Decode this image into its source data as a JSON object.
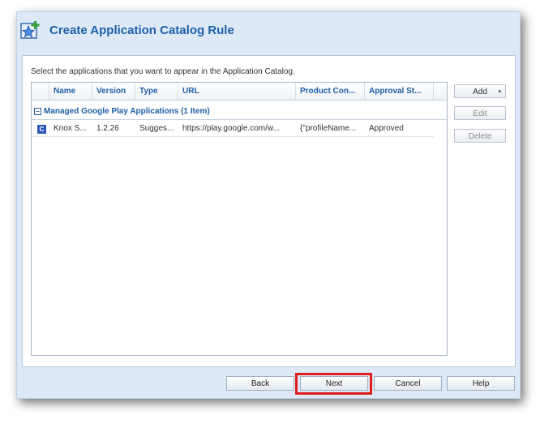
{
  "dialog": {
    "title": "Create Application Catalog Rule",
    "icon": "catalog-star-add-icon",
    "instruction": "Select the applications that you want to appear in the Application Catalog."
  },
  "grid": {
    "columns": [
      "Name",
      "Version",
      "Type",
      "URL",
      "Product Con...",
      "Approval St..."
    ],
    "group": {
      "toggle": "−",
      "label": "Managed Google Play Applications (1 Item)"
    },
    "rows": [
      {
        "icon_letter": "C",
        "name": "Knox S...",
        "version": "1.2.26",
        "type": "Sugges...",
        "url": "https://play.google.com/w...",
        "product_config": "{\"profileName...",
        "approval": "Approved"
      }
    ]
  },
  "side_buttons": {
    "add": "Add",
    "add_arrow": "▾",
    "edit": "Edit",
    "delete": "Delete"
  },
  "footer": {
    "back": "Back",
    "next": "Next",
    "cancel": "Cancel",
    "help": "Help"
  },
  "colors": {
    "title": "#1e5fa8",
    "highlight": "#e01c1c",
    "dialog_bg": "#dde9f7"
  }
}
